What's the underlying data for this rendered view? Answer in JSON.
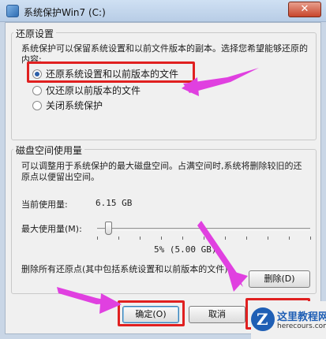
{
  "window": {
    "title": "系统保护Win7 (C:)",
    "close_label": "✕"
  },
  "restore_settings": {
    "group_title": "还原设置",
    "description": "系统保护可以保留系统设置和以前文件版本的副本。选择您希望能够还原的内容:",
    "options": [
      {
        "label": "还原系统设置和以前版本的文件",
        "checked": true
      },
      {
        "label": "仅还原以前版本的文件",
        "checked": false
      },
      {
        "label": "关闭系统保护",
        "checked": false
      }
    ]
  },
  "disk_usage": {
    "group_title": "磁盘空间使用量",
    "description": "可以调整用于系统保护的最大磁盘空间。占满空间时,系统将删除较旧的还原点以便留出空间。",
    "current_label": "当前使用量:",
    "current_value": "6.15 GB",
    "max_label": "最大使用量(M):",
    "slider_value": "5% (5.00 GB)",
    "slider_fraction": 0.05,
    "delete_text": "删除所有还原点(其中包括系统设置和以前版本的文件)。",
    "delete_button": "删除(D)"
  },
  "footer": {
    "ok_button": "确定(O)",
    "cancel_button": "取消"
  },
  "watermark": {
    "name": "这里教程网",
    "url": "herecours.com"
  },
  "colors": {
    "highlight": "#e02020",
    "arrow": "#e040e0",
    "watermark": "#1f5fb5"
  }
}
